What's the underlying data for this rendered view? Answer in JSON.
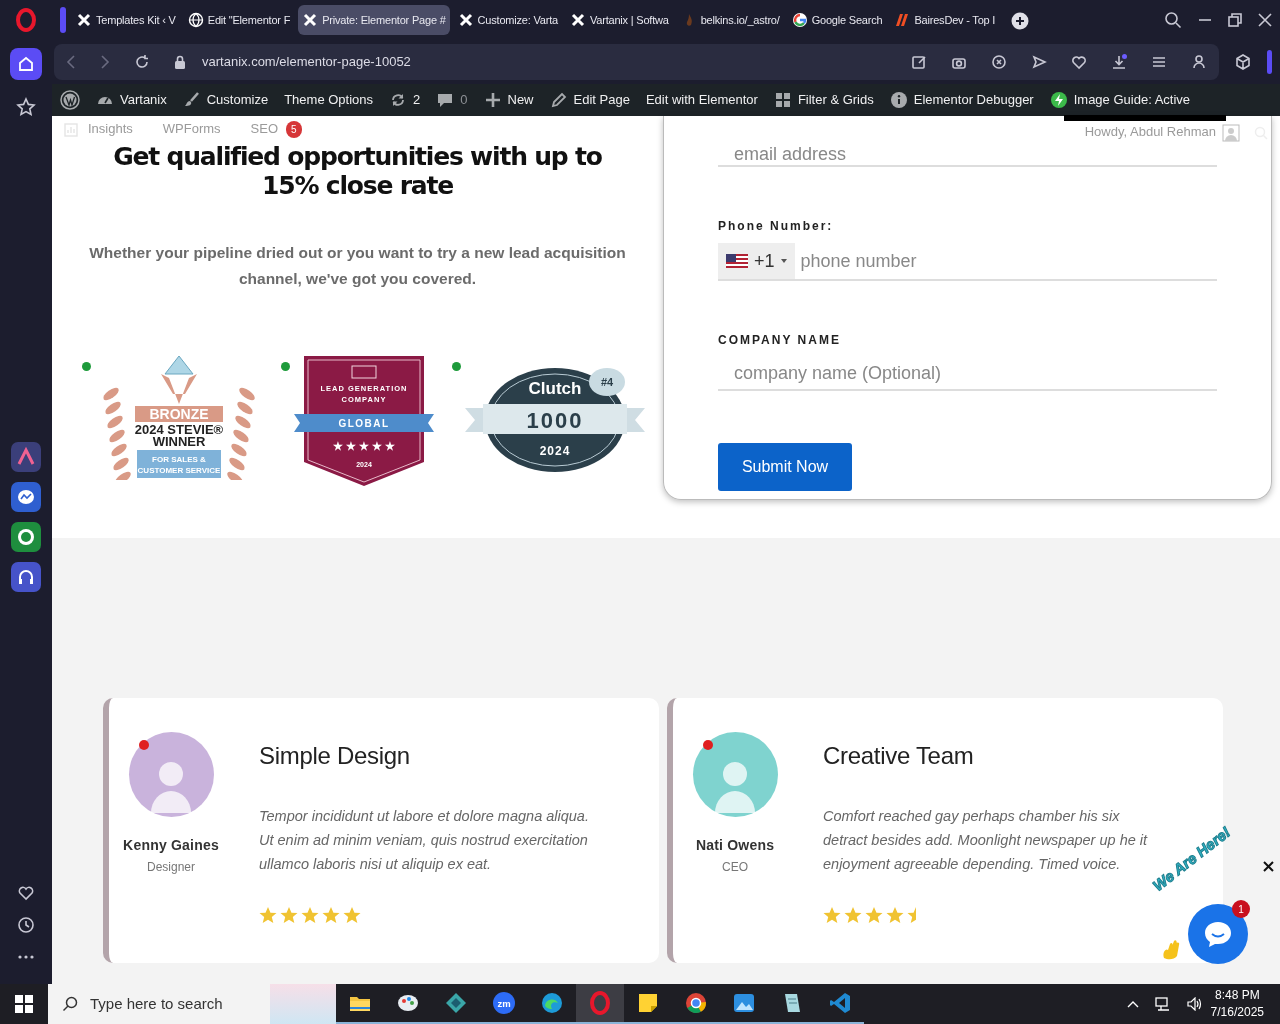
{
  "browser": {
    "tabs": [
      {
        "kind": "cross",
        "title": "Templates Kit ‹ V",
        "selected": false
      },
      {
        "kind": "globe",
        "title": "Edit \"Elementor F",
        "selected": false
      },
      {
        "kind": "cross",
        "title": "Private: Elementor Page #",
        "selected": true
      },
      {
        "kind": "cross",
        "title": "Customize: Varta",
        "selected": false
      },
      {
        "kind": "cross",
        "title": "Vartanix | Softwa",
        "selected": false
      },
      {
        "kind": "flame",
        "title": "belkins.io/_astro/",
        "selected": false
      },
      {
        "kind": "ring",
        "title": "Google Search",
        "selected": false
      },
      {
        "kind": "leaf",
        "title": "BairesDev - Top I",
        "selected": false
      }
    ],
    "address": "vartanix.com/elementor-page-10052"
  },
  "admin_bar": {
    "items": [
      {
        "kind": "dashboard",
        "label": "Vartanix"
      },
      {
        "kind": "brush",
        "label": "Customize"
      },
      {
        "kind": "plain",
        "label": "Theme Options"
      },
      {
        "kind": "updates",
        "label": "2"
      },
      {
        "kind": "comments",
        "label": "0"
      },
      {
        "kind": "plus",
        "label": "New"
      },
      {
        "kind": "pencil",
        "label": "Edit Page"
      },
      {
        "kind": "plain",
        "label": "Edit with Elementor"
      },
      {
        "kind": "grid",
        "label": "Filter & Grids"
      },
      {
        "kind": "info",
        "label": "Elementor Debugger"
      },
      {
        "kind": "bolt",
        "label": "Image Guide: Active"
      }
    ]
  },
  "admin_submenu": {
    "items": [
      {
        "label": "Insights"
      },
      {
        "label": "WPForms"
      },
      {
        "label": "SEO",
        "count": "5"
      }
    ],
    "greeting": "Howdy, Abdul Rehman"
  },
  "hero": {
    "heading": "Get qualified opportunities with up to 15% close rate",
    "subtext": "Whether your pipeline dried out or you want to try a new lead acquisition channel, we've got you covered."
  },
  "badges": [
    {
      "kind": "stevie",
      "lines": [
        "BRONZE",
        "2024 STEVIE®",
        "WINNER",
        "FOR SALES &",
        "CUSTOMER SERVICE"
      ]
    },
    {
      "kind": "shield",
      "lines": [
        "LEAD GENERATION",
        "COMPANY",
        "GLOBAL",
        "★ ★ ★ ★ ★",
        "2024"
      ]
    },
    {
      "kind": "clutch",
      "lines": [
        "Clutch",
        "1000",
        "2024",
        "#4"
      ]
    }
  ],
  "form": {
    "fields": [
      {
        "kind": "text",
        "placeholder": "email address"
      },
      {
        "kind": "phone",
        "label": "Phone Number:",
        "code": "+1",
        "placeholder": "phone number"
      },
      {
        "kind": "text",
        "label": "COMPANY NAME",
        "placeholder": "company name (Optional)"
      }
    ],
    "submit": "Submit Now"
  },
  "testimonials": [
    {
      "name": "Kenny Gaines",
      "role": "Designer",
      "title": "Simple Design",
      "quote": "Tempor incididunt ut labore et dolore magna aliqua. Ut enim ad minim veniam, quis nostrud exercitation ullamco laboris nisi ut aliquip ex eat.",
      "stars": 5
    },
    {
      "name": "Nati Owens",
      "role": "CEO",
      "title": "Creative Team",
      "quote": "Comfort reached gay perhaps chamber his six detract besides add. Moonlight newspaper up he it enjoyment agreeable depending. Timed voice.",
      "stars": 4.5
    }
  ],
  "chat": {
    "caption": "We Are Here!",
    "count": "1"
  },
  "taskbar": {
    "search_placeholder": "Type here to search",
    "apps": [
      {
        "kind": "folder",
        "selected": false
      },
      {
        "kind": "paint",
        "selected": false
      },
      {
        "kind": "diamond",
        "selected": false
      },
      {
        "kind": "zoom",
        "label": "zm",
        "selected": false
      },
      {
        "kind": "edge",
        "selected": false
      },
      {
        "kind": "opera",
        "selected": true
      },
      {
        "kind": "sticky",
        "selected": false
      },
      {
        "kind": "chrome",
        "selected": false
      },
      {
        "kind": "photos",
        "selected": false
      },
      {
        "kind": "notepad",
        "selected": false
      },
      {
        "kind": "vscode",
        "selected": false
      }
    ],
    "time": "8:48 PM",
    "date": "7/16/2025"
  }
}
